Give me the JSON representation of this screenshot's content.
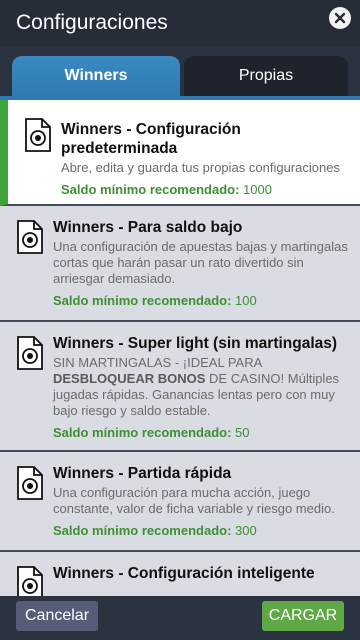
{
  "header": {
    "title": "Configuraciones",
    "close_icon": "close-icon"
  },
  "tabs": [
    {
      "label": "Winners",
      "active": true
    },
    {
      "label": "Propias",
      "active": false
    }
  ],
  "colors": {
    "header_bg": "#262d39",
    "tab_active": "#2f7ab3",
    "selected_accent": "#3fa43a",
    "saldo_green": "#3f8f35",
    "cargar_button": "#5fa845",
    "cancel_button": "#555d78"
  },
  "configs": [
    {
      "title": "Winners - Configuración predeterminada",
      "desc_pre": "Abre, edita y guarda tus propias configuraciones",
      "desc_bold": "",
      "desc_post": "",
      "saldo_label": "Saldo mínimo recomendado:",
      "saldo_value": "1000",
      "icon": "document-chip-icon",
      "selected": true
    },
    {
      "title": "Winners - Para saldo bajo",
      "desc_pre": "Una configuración de apuestas bajas y martingalas cortas que harán pasar un rato divertido sin arriesgar demasiado.",
      "desc_bold": "",
      "desc_post": "",
      "saldo_label": "Saldo mínimo recomendado:",
      "saldo_value": "100",
      "icon": "document-chip-icon",
      "selected": false
    },
    {
      "title": "Winners - Super light (sin martingalas)",
      "desc_pre": "SIN MARTINGALAS - ¡IDEAL PARA ",
      "desc_bold": "DESBLOQUEAR BONOS",
      "desc_post": " DE CASINO! Múltiples jugadas rápidas. Ganancias lentas pero con muy bajo riesgo y saldo estable.",
      "saldo_label": "Saldo mínimo recomendado:",
      "saldo_value": "50",
      "icon": "document-chip-icon",
      "selected": false
    },
    {
      "title": "Winners - Partida rápida",
      "desc_pre": "Una configuración para mucha acción, juego constante, valor de ficha variable y riesgo medio.",
      "desc_bold": "",
      "desc_post": "",
      "saldo_label": "Saldo mínimo recomendado:",
      "saldo_value": "300",
      "icon": "document-chip-icon",
      "selected": false
    },
    {
      "title": "Winners - Configuración inteligente",
      "desc_pre": "",
      "desc_bold": "",
      "desc_post": "",
      "saldo_label": "",
      "saldo_value": "",
      "icon": "document-chip-icon",
      "selected": false
    }
  ],
  "footer": {
    "cancel_label": "Cancelar",
    "load_label": "CARGAR"
  }
}
